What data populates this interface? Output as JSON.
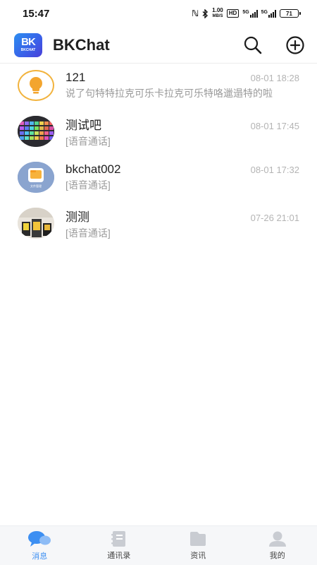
{
  "status_bar": {
    "time": "15:47",
    "net_speed_value": "1.00",
    "net_speed_unit": "MB/S",
    "hd_badge": "HD",
    "sim1_label": "5G",
    "sim2_label": "5G",
    "battery": "71"
  },
  "header": {
    "logo_mark": "BK",
    "logo_sub": "BKCHAT",
    "title": "BKChat"
  },
  "conversations": [
    {
      "name": "121",
      "time": "08-01 18:28",
      "preview": "说了句特特拉克可乐卡拉克可乐特咯邋遢特的啦",
      "avatar": "bulb"
    },
    {
      "name": "测试吧",
      "time": "08-01 17:45",
      "preview": "[语音通话]",
      "avatar": "keyboard"
    },
    {
      "name": "bkchat002",
      "time": "08-01 17:32",
      "preview": "[语音通话]",
      "avatar": "folder",
      "avatar_caption": "文件管理"
    },
    {
      "name": "测测",
      "time": "07-26 21:01",
      "preview": "[语音通话]",
      "avatar": "photo"
    }
  ],
  "tabs": [
    {
      "label": "消息",
      "icon": "chat-bubbles-icon",
      "active": true
    },
    {
      "label": "通讯录",
      "icon": "contacts-book-icon",
      "active": false
    },
    {
      "label": "资讯",
      "icon": "news-folder-icon",
      "active": false
    },
    {
      "label": "我的",
      "icon": "profile-icon",
      "active": false
    }
  ],
  "colors": {
    "accent": "#3d8ff2",
    "inactive_icon": "#c9ccd2",
    "time_text": "#b4b4b4"
  }
}
